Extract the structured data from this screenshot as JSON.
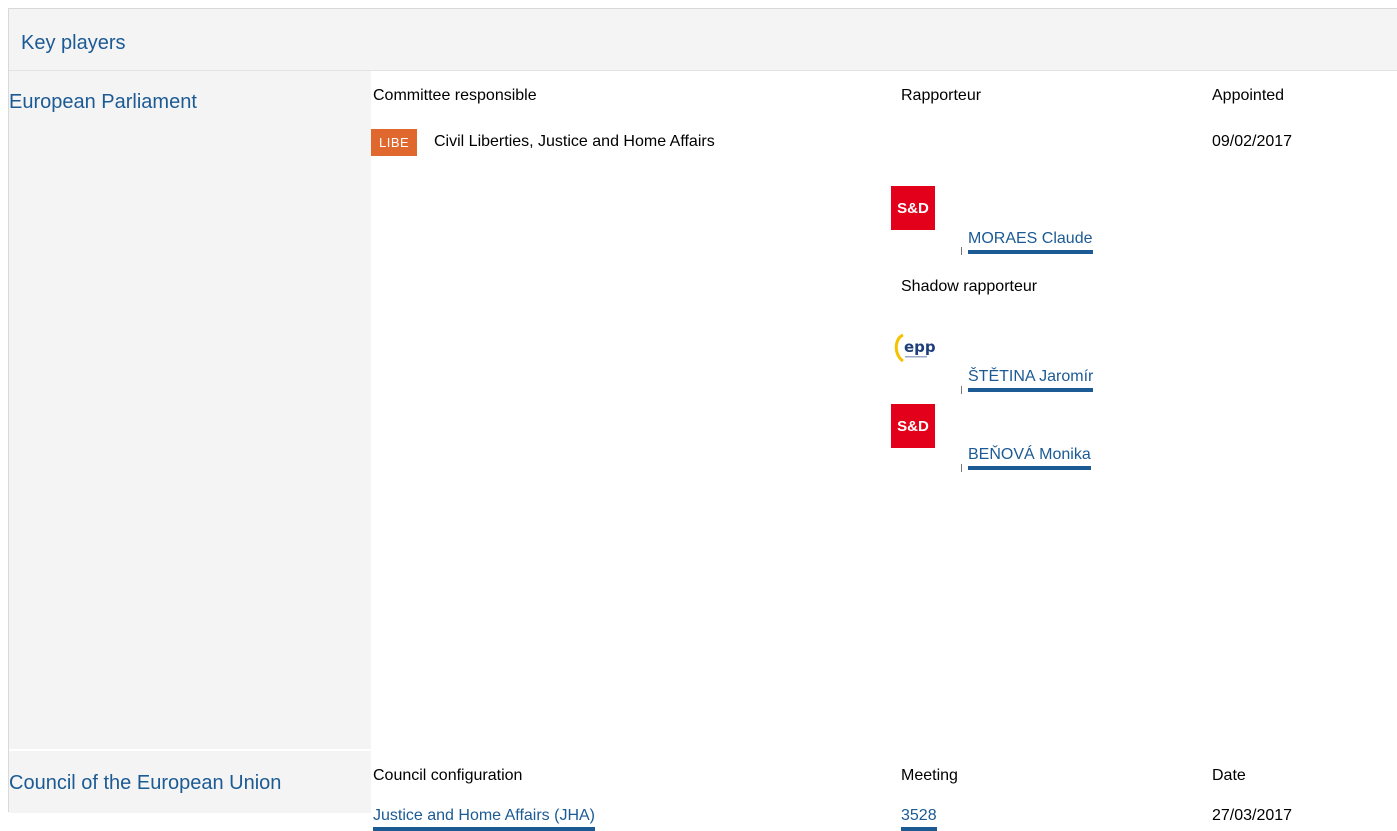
{
  "header": {
    "title": "Key players"
  },
  "parliament": {
    "label": "European Parliament",
    "col_committee": "Committee responsible",
    "col_rapporteur": "Rapporteur",
    "col_appointed": "Appointed",
    "committee_badge": "LIBE",
    "committee_name": "Civil Liberties, Justice and Home Affairs",
    "appointed_date": "09/02/2017",
    "rapporteur": {
      "party_logo": "S&D",
      "name": "MORAES Claude"
    },
    "shadow_label": "Shadow rapporteur",
    "shadows": [
      {
        "party_logo": "epp",
        "name": "ŠTĚTINA Jaromír"
      },
      {
        "party_logo": "S&D",
        "name": "BEŇOVÁ Monika"
      }
    ]
  },
  "council": {
    "label": "Council of the European Union",
    "col_configuration": "Council configuration",
    "col_meeting": "Meeting",
    "col_date": "Date",
    "configuration": "Justice and Home Affairs (JHA)",
    "meeting": "3528",
    "date": "27/03/2017"
  },
  "colors": {
    "accent_blue": "#1c5a94",
    "badge_orange": "#e0672e",
    "sd_red": "#e2001a",
    "panel_gray": "#f4f4f4"
  }
}
